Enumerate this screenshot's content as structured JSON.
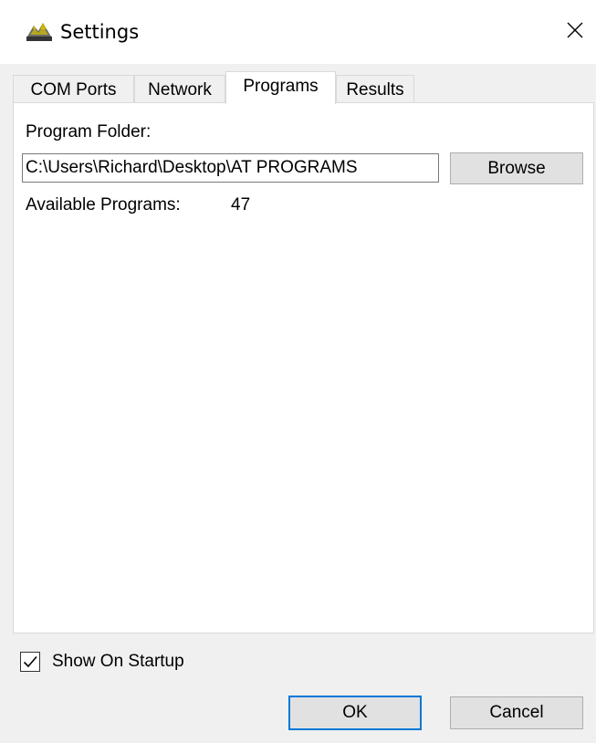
{
  "window": {
    "title": "Settings",
    "close_glyph": "×"
  },
  "tabs": [
    {
      "label": "COM Ports"
    },
    {
      "label": "Network"
    },
    {
      "label": "Programs"
    },
    {
      "label": "Results"
    }
  ],
  "active_tab": "Programs",
  "programs": {
    "folder_label": "Program Folder:",
    "folder_value": "C:\\Users\\Richard\\Desktop\\AT PROGRAMS",
    "browse_label": "Browse",
    "available_label": "Available Programs:",
    "available_count": "47"
  },
  "footer": {
    "show_on_startup_label": "Show On Startup",
    "show_on_startup_checked": true,
    "ok_label": "OK",
    "cancel_label": "Cancel"
  },
  "colors": {
    "accent": "#0078d7",
    "window_bg": "#f0f0f0",
    "page_bg": "#ffffff"
  }
}
